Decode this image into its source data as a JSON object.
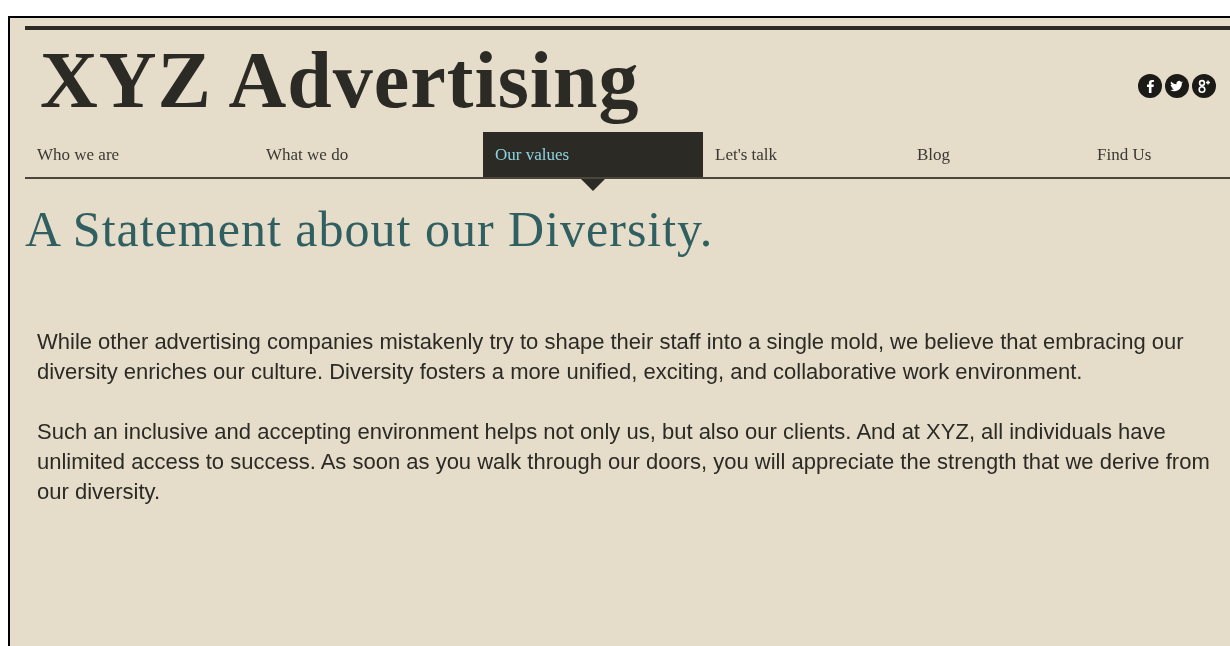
{
  "site_title": "XYZ Advertising",
  "nav": [
    {
      "label": "Who we are",
      "selected": false
    },
    {
      "label": "What we do",
      "selected": false
    },
    {
      "label": "Our values",
      "selected": true
    },
    {
      "label": "Let's talk",
      "selected": false
    },
    {
      "label": "Blog",
      "selected": false
    },
    {
      "label": "Find Us",
      "selected": false
    }
  ],
  "heading": "A Statement about our Diversity.",
  "paragraphs": [
    "While other advertising companies mistakenly try to shape their staff into a single mold, we believe that embracing our diversity enriches our culture. Diversity fosters a more unified, exciting, and collaborative work environment.",
    "Such an inclusive and accepting environment helps not only us, but also our clients. And at XYZ, all individuals have unlimited access to success. As soon as you walk through our doors, you will appreciate the strength that we derive from our diversity."
  ]
}
